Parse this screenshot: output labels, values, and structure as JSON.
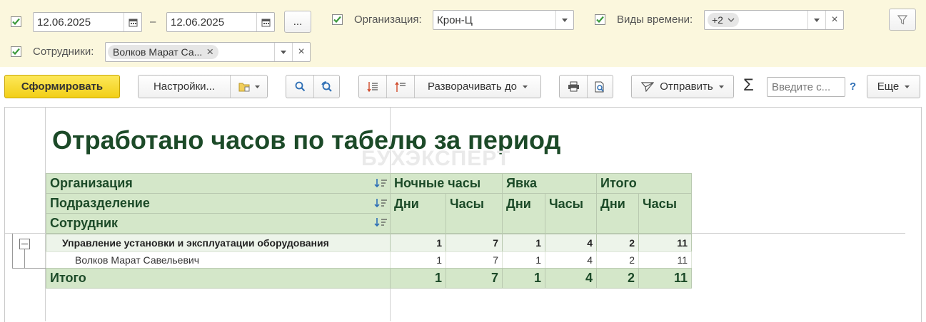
{
  "filters": {
    "date_from": "12.06.2025",
    "date_sep": "–",
    "date_to": "12.06.2025",
    "period_btn": "...",
    "org_label": "Организация:",
    "org_value": "Крон-Ц",
    "time_types_label": "Виды времени:",
    "time_types_tag": "+2",
    "employees_label": "Сотрудники:",
    "employees_tag": "Волков Марат Са...",
    "clear_glyph": "×"
  },
  "toolbar": {
    "generate": "Сформировать",
    "settings": "Настройки...",
    "expand_to": "Разворачивать до",
    "send": "Отправить",
    "sum_glyph": "Σ",
    "search_placeholder": "Введите с...",
    "help": "?",
    "more": "Еще"
  },
  "report": {
    "title": "Отработано часов по табелю за период",
    "watermark": "БУХЭКСПЕРТ",
    "row_headers": [
      "Организация",
      "Подразделение",
      "Сотрудник"
    ],
    "groups": [
      "Ночные часы",
      "Явка",
      "Итого"
    ],
    "subcols": [
      "Дни",
      "Часы",
      "Дни",
      "Часы",
      "Дни",
      "Часы"
    ],
    "rows": [
      {
        "label": "Управление установки и эксплуатации оборудования",
        "values": [
          "1",
          "7",
          "1",
          "4",
          "2",
          "11"
        ]
      },
      {
        "label": "Волков Марат Савельевич",
        "values": [
          "1",
          "7",
          "1",
          "4",
          "2",
          "11"
        ]
      }
    ],
    "total": {
      "label": "Итого",
      "values": [
        "1",
        "7",
        "1",
        "4",
        "2",
        "11"
      ]
    }
  }
}
